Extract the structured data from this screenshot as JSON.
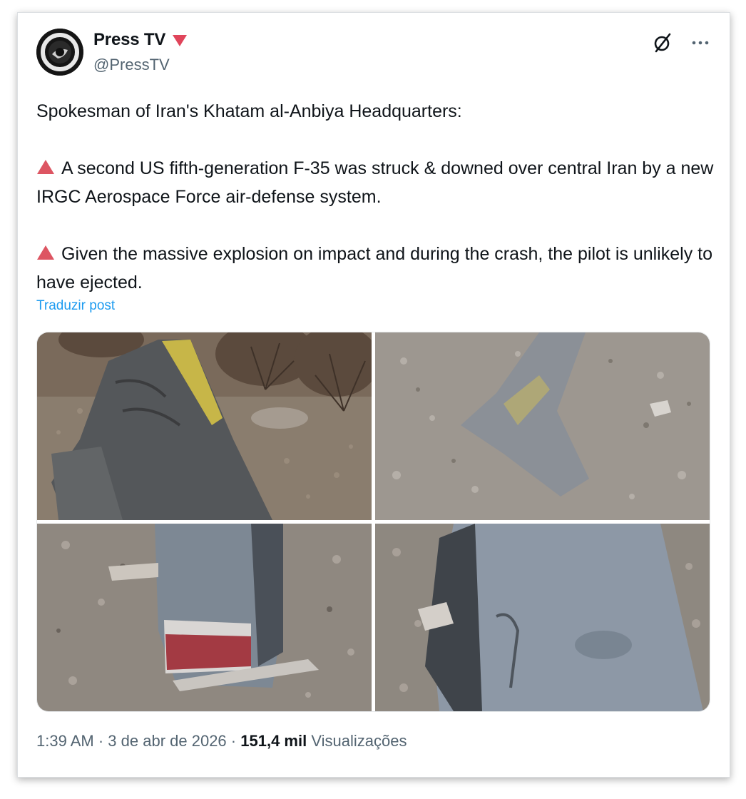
{
  "author": {
    "display_name": "Press TV",
    "handle": "@PressTV",
    "badge_icon": "red-triangle-icon",
    "badge_color": "#e0245e"
  },
  "header_actions": {
    "grok_icon": "grok-slash-circle-icon",
    "more_icon": "more-dots-icon"
  },
  "tweet": {
    "line1": "Spokesman of Iran's Khatam al-Anbiya Headquarters:",
    "bullet1": "A second US fifth-generation F-35 was struck & downed over central Iran by a new IRGC Aerospace Force air-defense system.",
    "bullet2": "Given the massive explosion on impact and during the crash, the pilot is unlikely to have ejected.",
    "bullet_icon": "red-triangle-icon",
    "bullet_color": "#dd5562"
  },
  "translate_label": "Traduzir post",
  "media": {
    "photo_count": 4
  },
  "meta": {
    "time": "1:39 AM",
    "separator": "·",
    "date": "3 de abr de 2026",
    "views_count": "151,4 mil",
    "views_label": "Visualizações"
  },
  "colors": {
    "text": "#0f1419",
    "secondary": "#536471",
    "link": "#1d9bf0"
  }
}
